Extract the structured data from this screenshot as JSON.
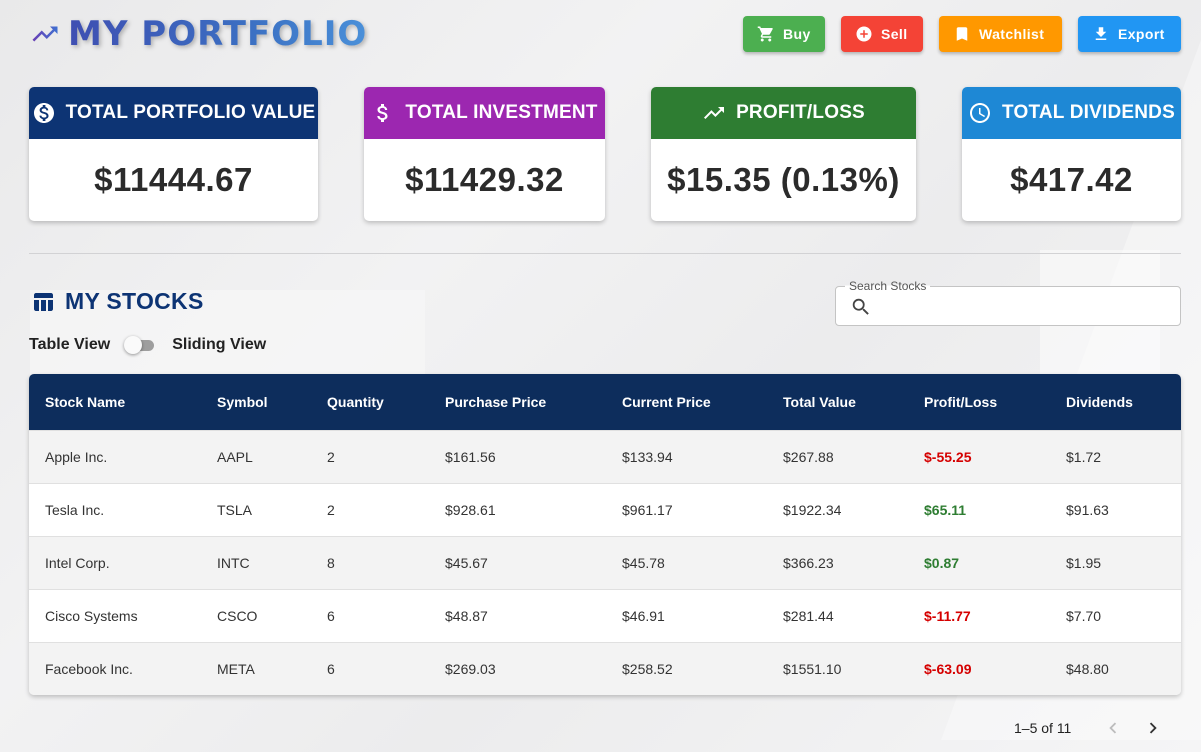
{
  "header": {
    "title": "MY PORTFOLIO",
    "icon": "trending-up-icon",
    "buttons": {
      "buy": "Buy",
      "sell": "Sell",
      "watchlist": "Watchlist",
      "export": "Export"
    }
  },
  "summary": {
    "total_value": {
      "label": "TOTAL PORTFOLIO VALUE",
      "value": "$11444.67",
      "icon": "dollar-circle-icon",
      "color": "#0d3474"
    },
    "total_investment": {
      "label": "TOTAL INVESTMENT",
      "value": "$11429.32",
      "icon": "dollar-icon",
      "color": "#9c27b0"
    },
    "profit_loss": {
      "label": "PROFIT/LOSS",
      "value": "$15.35 (0.13%)",
      "icon": "trending-up-icon",
      "color": "#2e7d32"
    },
    "dividends": {
      "label": "TOTAL DIVIDENDS",
      "value": "$417.42",
      "icon": "clock-icon",
      "color": "#1e88d5"
    }
  },
  "stocks": {
    "title": "MY STOCKS",
    "view_toggle": {
      "left": "Table View",
      "right": "Sliding View",
      "checked": false
    },
    "search": {
      "label": "Search Stocks",
      "value": "",
      "placeholder": ""
    },
    "columns": [
      "Stock Name",
      "Symbol",
      "Quantity",
      "Purchase Price",
      "Current Price",
      "Total Value",
      "Profit/Loss",
      "Dividends"
    ],
    "rows": [
      {
        "name": "Apple Inc.",
        "symbol": "AAPL",
        "quantity": "2",
        "purchase": "$161.56",
        "current": "$133.94",
        "total": "$267.88",
        "pl": "$-55.25",
        "pl_status": "loss",
        "dividends": "$1.72"
      },
      {
        "name": "Tesla Inc.",
        "symbol": "TSLA",
        "quantity": "2",
        "purchase": "$928.61",
        "current": "$961.17",
        "total": "$1922.34",
        "pl": "$65.11",
        "pl_status": "gain",
        "dividends": "$91.63"
      },
      {
        "name": "Intel Corp.",
        "symbol": "INTC",
        "quantity": "8",
        "purchase": "$45.67",
        "current": "$45.78",
        "total": "$366.23",
        "pl": "$0.87",
        "pl_status": "gain",
        "dividends": "$1.95"
      },
      {
        "name": "Cisco Systems",
        "symbol": "CSCO",
        "quantity": "6",
        "purchase": "$48.87",
        "current": "$46.91",
        "total": "$281.44",
        "pl": "$-11.77",
        "pl_status": "loss",
        "dividends": "$7.70"
      },
      {
        "name": "Facebook Inc.",
        "symbol": "META",
        "quantity": "6",
        "purchase": "$269.03",
        "current": "$258.52",
        "total": "$1551.10",
        "pl": "$-63.09",
        "pl_status": "loss",
        "dividends": "$48.80"
      }
    ],
    "pagination": {
      "range": "1–5 of 11"
    }
  },
  "colors": {
    "gain": "#2e7d32",
    "loss": "#d50000",
    "header_bg": "#0d2d5c"
  }
}
